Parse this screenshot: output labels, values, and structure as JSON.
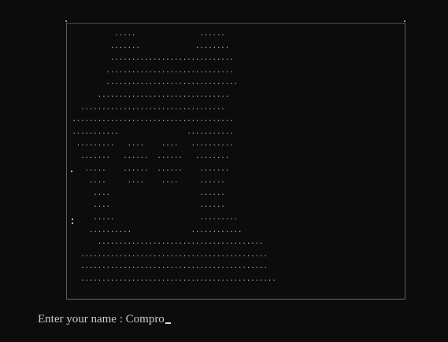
{
  "ascii_art": [
    "           .....               ......",
    "          .......             ........",
    "          .............................",
    "         ..............................",
    "         ...............................",
    "       ...............................",
    "   ..................................",
    " ......................................",
    " ...........                ...........",
    "  .........   ....    ....   ..........",
    "   .......   ......  ......   ........",
    "    .....    ......  ......    .......",
    "     ....     ....    ....     ......",
    "      ....                     ......",
    "      ....                     ......",
    "      .....                    .........",
    "     ..........              ............",
    "       .......................................",
    "   ............................................",
    "   ............................................",
    "   .............................................."
  ],
  "prompt": {
    "label": "Enter your name : ",
    "value": "Compro"
  }
}
